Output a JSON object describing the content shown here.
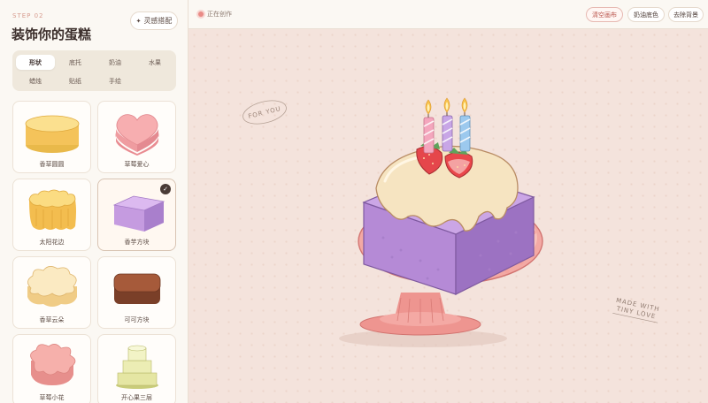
{
  "sidebar": {
    "step": "STEP 02",
    "title": "装饰你的蛋糕",
    "inspire_label": "灵感搭配",
    "inspire_icon": "sparkle-icon",
    "tabs": [
      {
        "label": "形状",
        "active": true
      },
      {
        "label": "底托"
      },
      {
        "label": "奶油"
      },
      {
        "label": "水果"
      },
      {
        "label": "蜡烛"
      },
      {
        "label": "贴纸"
      },
      {
        "label": "手绘"
      }
    ],
    "shapes": [
      {
        "label": "香草圆圆"
      },
      {
        "label": "草莓爱心"
      },
      {
        "label": "太阳花边"
      },
      {
        "label": "香芋方块",
        "selected": true
      },
      {
        "label": "香草云朵"
      },
      {
        "label": "可可方块"
      },
      {
        "label": "草莓小花"
      },
      {
        "label": "开心果三层"
      }
    ]
  },
  "topbar": {
    "status": "正在创作",
    "buttons": [
      "清空画布",
      "奶油底色",
      "去除背景"
    ]
  },
  "canvas": {
    "stamp_left": "FOR YOU",
    "stamp_right_line1": "MADE WITH",
    "stamp_right_line2": "TINY LOVE"
  },
  "colors": {
    "accent": "#e98b86",
    "cake_purple": "#b48fd4",
    "cream": "#f7e6c4",
    "plate_pink": "#ef9b98"
  }
}
